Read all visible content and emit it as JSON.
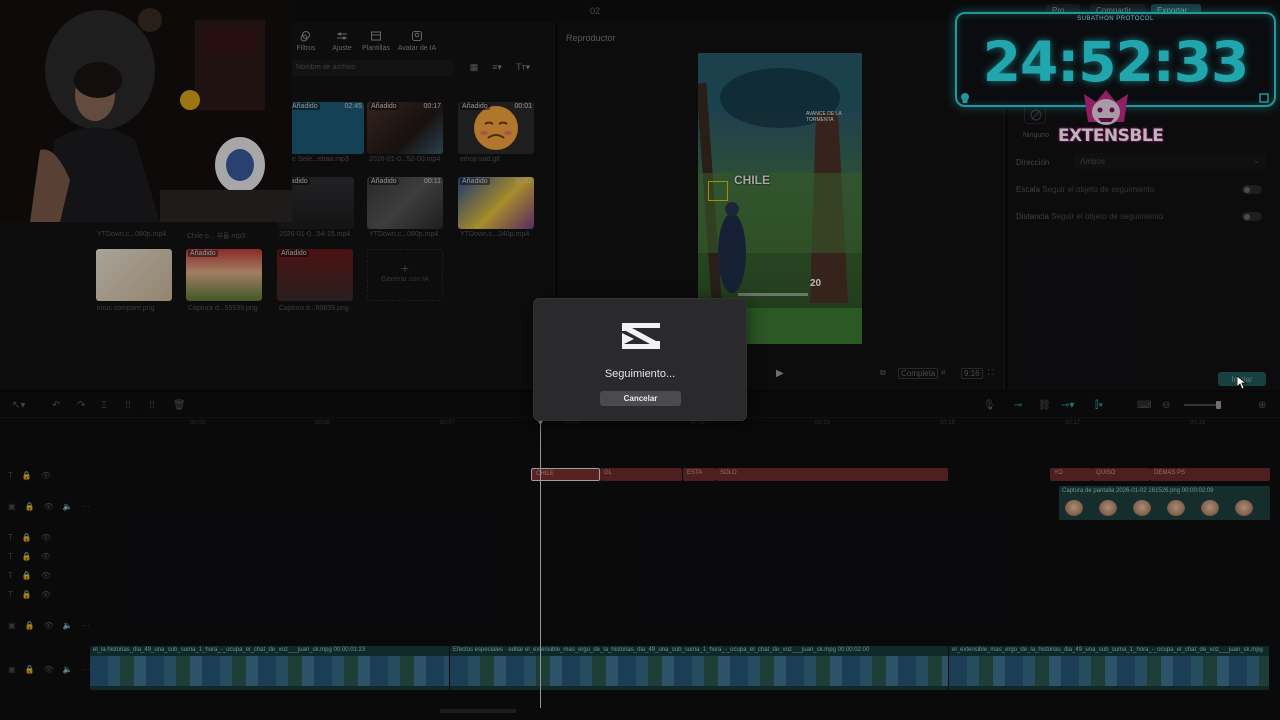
{
  "topbar": {
    "project_name": "02",
    "right_buttons": [
      "Pro",
      "Compartir",
      "Exportar"
    ]
  },
  "media_panel": {
    "tools": [
      {
        "label": "Filtros",
        "icon": "filter-icon"
      },
      {
        "label": "Ajuste",
        "icon": "sliders-icon"
      },
      {
        "label": "Plantillas",
        "icon": "template-icon"
      },
      {
        "label": "Avatar de IA",
        "icon": "avatar-ai-icon"
      }
    ],
    "search_placeholder": "Nombre de archivo",
    "items": [
      {
        "name": "e Sele...ebaa.mp3",
        "badge": "Añadido",
        "duration": "02:45"
      },
      {
        "name": "2026-01-0...52-00.mp4",
        "badge": "Añadido",
        "duration": "00:17"
      },
      {
        "name": "emoji-sad.gif",
        "badge": "Añadido",
        "duration": "00:01"
      },
      {
        "name": "YTDown.c...080p.mp4",
        "badge": "Añadido",
        "duration": ""
      },
      {
        "name": "Chile o... 부들.mp3",
        "badge": "",
        "duration": ""
      },
      {
        "name": "2026-01-0...54-15.mp4",
        "badge": "Añadido",
        "duration": ""
      },
      {
        "name": "YTDown.c...080p.mp4",
        "badge": "Añadido",
        "duration": "00:11"
      },
      {
        "name": "YTDown.c...240p.mp4",
        "badge": "Añadido",
        "duration": "00:11"
      },
      {
        "name": "knus compare.png",
        "badge": "",
        "duration": ""
      },
      {
        "name": "Captura d...55539.png",
        "badge": "Añadido",
        "duration": ""
      },
      {
        "name": "Captura d...60839.png",
        "badge": "Añadido",
        "duration": ""
      }
    ],
    "generate_label": "Generar con IA"
  },
  "player": {
    "title": "Reproductor",
    "overlay_text": "CHILE",
    "hud_number": "20",
    "hud_banner": "AVANCE DE LA TORMENTA",
    "ratio_label": "Completa",
    "aspect_label": "9:16"
  },
  "properties": {
    "none_label": "Ninguno",
    "direction_label": "Dirección",
    "direction_value": "Ambos",
    "scale_label": "Escala",
    "scale_value": "Seguir el objeto de seguimiento",
    "distance_label": "Distancia",
    "distance_value": "Seguir el objeto de seguimiento",
    "start_button": "Iniciar"
  },
  "overlay_timer": {
    "caption": "SUBATHON PROTOCOL",
    "time": "24:52:33",
    "brand": "EXTENSBLE"
  },
  "timeline": {
    "ruler_ticks": [
      "00:03",
      "00:05",
      "00:07",
      "00:09",
      "00:11",
      "00:13",
      "00:15",
      "00:17",
      "00:19",
      "00:21"
    ],
    "text_clips": [
      "CHILE",
      "GL",
      "ESTA",
      "SOLO",
      "YO",
      "QUISO",
      "DEMAS PS"
    ],
    "image_clip_label": "Captura de pantalla 2026-01-02 161526.png  00:00:02:09",
    "main_segments": [
      {
        "label": "el_la historias_dia_49_una_sub_suma_1_hora_-_ocupa_el_chat_de_voz___juan_sk.mpg  00:00:01:23"
      },
      {
        "label": "Efectos especiales · editar  el_extensible_mas_ergo_de_la_historias_dia_49_una_sub_suma_1_hora_-_ocupa_el_chat_de_voz___juan_sk.mpg  00:00:02:00"
      },
      {
        "label": "el_extensible_mas_ergo_de_la_historias_dia_49_una_sub_suma_1_hora_-_ocupa_el_chat_de_voz___juan_sk.mpg"
      }
    ]
  },
  "dialog": {
    "message": "Seguimiento...",
    "cancel_label": "Cancelar"
  },
  "colors": {
    "accent": "#2fd3d9",
    "text_clip": "#6e2a2a",
    "main_track": "#163a3a"
  }
}
